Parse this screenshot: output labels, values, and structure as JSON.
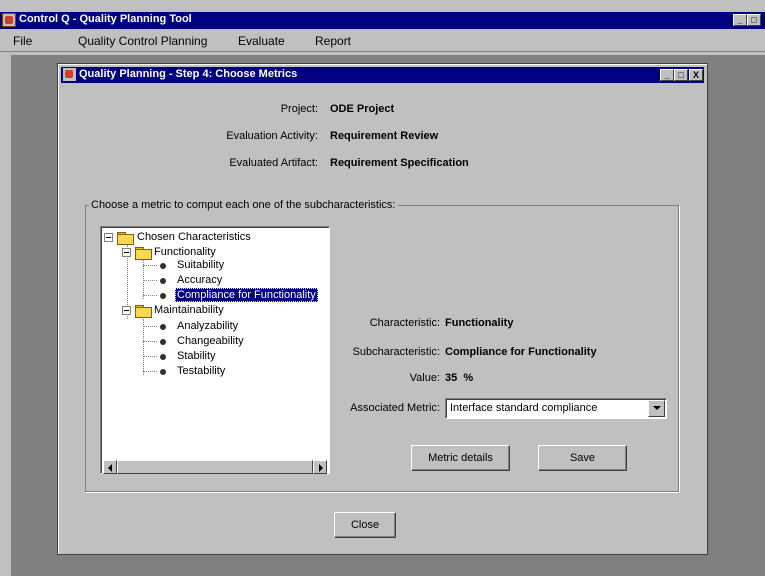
{
  "app": {
    "title": "Control Q - Quality Planning Tool",
    "menu": [
      "File",
      "Quality Control Planning",
      "Evaluate",
      "Report"
    ],
    "window_buttons": {
      "minimize": "_",
      "maximize": "□",
      "close": "X"
    }
  },
  "dialog": {
    "title": "Quality Planning - Step 4: Choose Metrics",
    "info": [
      {
        "label": "Project:",
        "value": "ODE Project"
      },
      {
        "label": "Evaluation Activity:",
        "value": "Requirement Review"
      },
      {
        "label": "Evaluated Artifact:",
        "value": "Requirement Specification"
      }
    ],
    "group_title": "Choose a metric to comput each one of the subcharacteristics:",
    "tree": {
      "root": "Chosen Characteristics",
      "characteristics": [
        {
          "name": "Functionality",
          "subs": [
            "Suitability",
            "Accuracy",
            "Compliance for Functionality"
          ]
        },
        {
          "name": "Maintainability",
          "subs": [
            "Analyzability",
            "Changeability",
            "Stability",
            "Testability"
          ]
        }
      ],
      "selected": "Compliance for Functionality"
    },
    "details": {
      "characteristic_label": "Characteristic:",
      "characteristic_value": "Functionality",
      "subcharacteristic_label": "Subcharacteristic:",
      "subcharacteristic_value": "Compliance for Functionality",
      "value_label": "Value:",
      "value_value": "35  %",
      "metric_label": "Associated Metric:",
      "metric_value": "Interface standard compliance"
    },
    "buttons": {
      "metric_details": "Metric details",
      "save": "Save",
      "close": "Close"
    }
  }
}
